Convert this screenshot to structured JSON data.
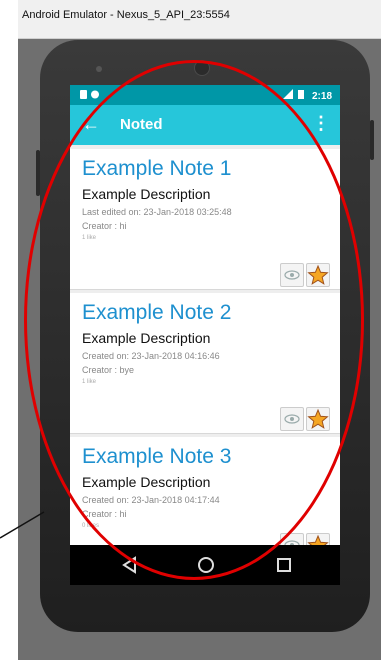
{
  "window": {
    "title": "Android Emulator - Nexus_5_API_23:5554"
  },
  "status_bar": {
    "time": "2:18",
    "icons": [
      "sim-icon",
      "android-icon",
      "signal-icon",
      "battery-icon"
    ]
  },
  "toolbar": {
    "title": "Noted",
    "back_icon": "arrow-back-icon",
    "menu_icon": "overflow-menu-icon"
  },
  "notes": [
    {
      "title": "Example Note 1",
      "description": "Example Description",
      "date": "Last edited on: 23-Jan-2018 03:25:48",
      "creator": "Creator : hi",
      "likes": "1 like"
    },
    {
      "title": "Example Note 2",
      "description": "Example Description",
      "date": "Created on: 23-Jan-2018 04:16:46",
      "creator": "Creator : bye",
      "likes": "1 like"
    },
    {
      "title": "Example Note 3",
      "description": "Example Description",
      "date": "Created on: 23-Jan-2018 04:17:44",
      "creator": "Creator : hi",
      "likes": "0 likes"
    }
  ],
  "card_icons": [
    "eye-icon",
    "star-icon"
  ],
  "nav": {
    "icons": [
      "back-triangle-icon",
      "home-circle-icon",
      "recents-square-icon"
    ]
  },
  "colors": {
    "status_bar": "#0097a7",
    "toolbar": "#26c6da",
    "note_title": "#1e90cf",
    "highlight": "#e00000"
  }
}
